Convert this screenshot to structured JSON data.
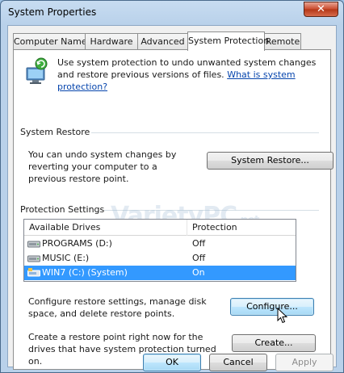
{
  "window": {
    "title": "System Properties",
    "close_label": "✕"
  },
  "tabs": [
    {
      "label": "Computer Name",
      "active": false
    },
    {
      "label": "Hardware",
      "active": false
    },
    {
      "label": "Advanced",
      "active": false
    },
    {
      "label": "System Protection",
      "active": true
    },
    {
      "label": "Remote",
      "active": false
    }
  ],
  "intro": {
    "text": "Use system protection to undo unwanted system changes and restore previous versions of files.",
    "link": "What is system protection?"
  },
  "system_restore": {
    "heading": "System Restore",
    "text": "You can undo system changes by reverting your computer to a previous restore point.",
    "button": "System Restore..."
  },
  "protection": {
    "heading": "Protection Settings",
    "columns": [
      "Available Drives",
      "Protection"
    ],
    "drives": [
      {
        "name": "PROGRAMS (D:)",
        "protection": "Off",
        "selected": false
      },
      {
        "name": "MUSIC (E:)",
        "protection": "Off",
        "selected": false
      },
      {
        "name": "WIN7 (C:) (System)",
        "protection": "On",
        "selected": true
      }
    ],
    "configure_text": "Configure restore settings, manage disk space, and delete restore points.",
    "configure_button": "Configure...",
    "create_text": "Create a restore point right now for the drives that have system protection turned on.",
    "create_button": "Create..."
  },
  "watermark": {
    "main": "VarietyPC",
    "suffix": ".net"
  },
  "footer": {
    "ok": "OK",
    "cancel": "Cancel",
    "apply": "Apply"
  },
  "colors": {
    "selection": "#3399ff",
    "link": "#0645ad"
  }
}
